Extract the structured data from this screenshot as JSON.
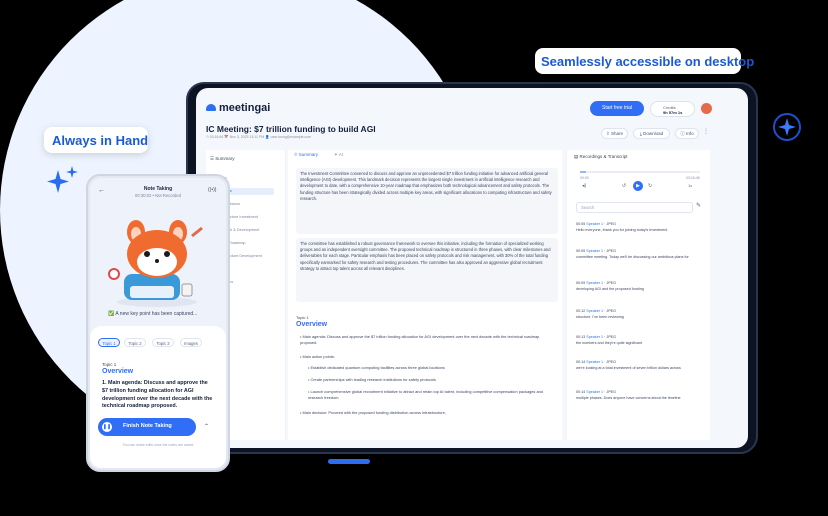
{
  "callouts": {
    "desktop": "Seamlessly accessible on desktop",
    "hand": "Always in Hand"
  },
  "colors": {
    "accent": "#2f6ef5",
    "background": "#000000",
    "circle": "#edf4ff"
  },
  "app": {
    "logo": "meetingai",
    "trial_button": "Start free trial",
    "credits_label": "Credits",
    "credits_value": "9h 57m 1s",
    "title": "IC Meeting: $7 trillion funding to build AGI",
    "meta": "⏱ 03:16:46   📅 Nov 3, 2023 13:11 PM   👤 user.luong@example.com",
    "actions": {
      "share": "Share",
      "download": "Download",
      "info": "Info",
      "more": "⋮"
    },
    "sidebar": {
      "heading": "Summary",
      "items": [
        "Topics",
        "Overview",
        "Key Decisions",
        "Infrastructure Investment",
        "Research & Development",
        "Overall Roadmap",
        "Infrastructure Development",
        "Finance",
        "Questions"
      ],
      "active_index": 1
    },
    "tabs": {
      "summary": "Summary",
      "ai": "AI"
    },
    "paragraph1": "The Investment Committee convened to discuss and approve an unprecedented $7 trillion funding initiative for advanced artificial general intelligence (AGI) development. This landmark decision represents the largest single investment in artificial intelligence research and development to date, with a comprehensive 10-year roadmap that emphasizes both technological advancement and safety protocols. The funding structure has been strategically divided across multiple key areas, with significant allocations to computing infrastructure and safety research.",
    "paragraph2": "The committee has established a robust governance framework to oversee this initiative, including the formation of specialized working groups and an independent oversight committee. The proposed technical roadmap is structured in three phases, with clear milestones and deliverables for each stage. Particular emphasis has been placed on safety protocols and risk management, with 30% of the total funding specifically earmarked for safety research and testing procedures. The committee has also approved an aggressive global recruitment strategy to attract top talent across all relevant disciplines.",
    "topic_label": "Topic 1",
    "overview": "Overview",
    "bullets": [
      "Main agenda: Discuss and approve the $7 trillion funding allocation for AGI development over the next decade with the technical roadmap proposed.",
      "Main action points:"
    ],
    "sub_bullets": [
      "Establish dedicated quantum computing facilities across three global locations",
      "Create partnerships with leading research institutions for safety protocols",
      "Launch comprehensive global recruitment initiative to attract and retain top AI talent, including competitive compensation packages and research freedom"
    ],
    "last_bullet": "Main decision: Proceed with the proposed funding distribution across infrastructure,",
    "recordings": {
      "title": "Recordings & Transcript",
      "time_start": "00:00",
      "time_end": "03:16:48",
      "search_placeholder": "Search",
      "lines": [
        {
          "time": "00:05",
          "speaker": "Speaker 1",
          "tag": "JPEG",
          "text": "Hello everyone, thank you for joining today's Investment"
        },
        {
          "time": "00:05",
          "speaker": "Speaker 1",
          "tag": "JPEG",
          "text": "committee meeting. Today we'll be discussing our ambitious plans for"
        },
        {
          "time": "00:09",
          "speaker": "Speaker 1",
          "tag": "JPEG",
          "text": "developing AGI and the proposed funding"
        },
        {
          "time": "00:12",
          "speaker": "Speaker 1",
          "tag": "JPEG",
          "text": "structure, I've been reviewing"
        },
        {
          "time": "00:13",
          "speaker": "Speaker 1",
          "tag": "JPEG",
          "text": "the numbers and they're quite significant"
        },
        {
          "time": "00:14",
          "speaker": "Speaker 1",
          "tag": "JPEG",
          "text": "we're looking at a total investment of seven trillion dollars across"
        },
        {
          "time": "00:14",
          "speaker": "Speaker 1",
          "tag": "JPEG",
          "text": "multiple phases. Does anyone have concerns about the timeline"
        }
      ]
    }
  },
  "phone": {
    "title": "Note Taking",
    "time": "00:30:02 • Not Recorded",
    "toast": "✅ A new key point has been captured...",
    "pills": [
      "Topic 1",
      "Topic 2",
      "Topic 3",
      "Images"
    ],
    "topic_label": "Topic 1",
    "overview": "Overview",
    "body": "1. Main agenda: Discuss and approve the $7 trillion funding allocation for AGI development over the next decade with the technical roadmap proposed.",
    "finish": "Finish Note Taking",
    "note": "You can make edits once the notes are saved"
  }
}
